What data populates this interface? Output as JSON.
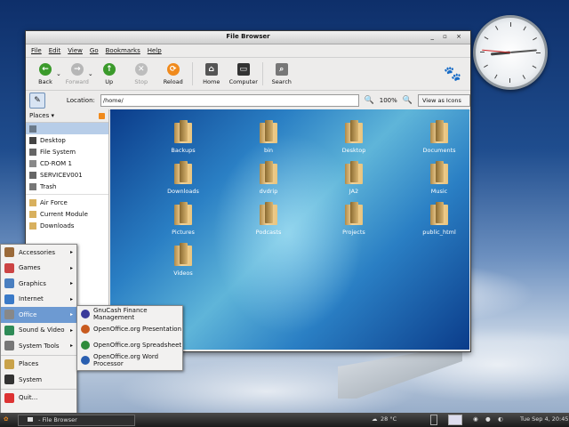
{
  "window": {
    "title": "File Browser",
    "controls": "_ ▫ ×",
    "menus": [
      "File",
      "Edit",
      "View",
      "Go",
      "Bookmarks",
      "Help"
    ],
    "toolbar": [
      {
        "label": "Back",
        "icon": "back-arrow-icon",
        "color": "#3b9a2b",
        "dim": false
      },
      {
        "label": "Forward",
        "icon": "forward-arrow-icon",
        "color": "#b6b6b6",
        "dim": true
      },
      {
        "label": "Up",
        "icon": "up-arrow-icon",
        "color": "#3b9a2b",
        "dim": false
      },
      {
        "label": "Stop",
        "icon": "stop-icon",
        "color": "#bdbdbd",
        "dim": true
      },
      {
        "label": "Reload",
        "icon": "reload-icon",
        "color": "#f08a1c",
        "dim": false
      },
      {
        "label": "Home",
        "icon": "home-icon",
        "color": "#555555",
        "dim": false
      },
      {
        "label": "Computer",
        "icon": "computer-icon",
        "color": "#333333",
        "dim": false
      },
      {
        "label": "Search",
        "icon": "search-icon",
        "color": "#777777",
        "dim": false
      }
    ],
    "location_label": "Location:",
    "location_value": "/home/",
    "zoom": "100%",
    "view_mode": "View as Icons"
  },
  "sidebar": {
    "header": "Places ▾",
    "items": [
      {
        "label": "",
        "icon": "home-icon",
        "selected": true
      },
      {
        "label": "Desktop",
        "icon": "desktop-icon"
      },
      {
        "label": "File System",
        "icon": "drive-icon"
      },
      {
        "label": "CD-ROM 1",
        "icon": "cdrom-icon"
      },
      {
        "label": "SERVICEV001",
        "icon": "drive-icon"
      },
      {
        "label": "Trash",
        "icon": "trash-icon"
      },
      {
        "label": "Air Force",
        "icon": "folder-icon"
      },
      {
        "label": "Current Module",
        "icon": "folder-icon"
      },
      {
        "label": "Downloads",
        "icon": "folder-icon"
      }
    ]
  },
  "files": [
    "Backups",
    "bin",
    "Desktop",
    "Documents",
    "Downloads",
    "dvdrip",
    "JA2",
    "Music",
    "Pictures",
    "Podcasts",
    "Projects",
    "public_html",
    "Videos"
  ],
  "app_menu": [
    {
      "label": "Accessories",
      "has_sub": true,
      "color": "#9b6a3a"
    },
    {
      "label": "Games",
      "has_sub": true,
      "color": "#c44"
    },
    {
      "label": "Graphics",
      "has_sub": true,
      "color": "#4a7fc0"
    },
    {
      "label": "Internet",
      "has_sub": true,
      "color": "#3a7ac8"
    },
    {
      "label": "Office",
      "has_sub": true,
      "color": "#888",
      "highlighted": true
    },
    {
      "label": "Sound & Video",
      "has_sub": true,
      "color": "#2e8b57"
    },
    {
      "label": "System Tools",
      "has_sub": true,
      "color": "#777"
    },
    {
      "label": "Places",
      "has_sub": false,
      "color": "#c9a24a"
    },
    {
      "label": "System",
      "has_sub": false,
      "color": "#333"
    },
    {
      "label": "Quit...",
      "has_sub": false,
      "color": "#d33"
    }
  ],
  "office_submenu": [
    {
      "label": "GnuCash Finance Management",
      "color": "#3a3a9a"
    },
    {
      "label": "OpenOffice.org Presentation",
      "color": "#c85a1e"
    },
    {
      "label": "OpenOffice.org Spreadsheet",
      "color": "#2e8b3a"
    },
    {
      "label": "OpenOffice.org Word Processor",
      "color": "#2a5fb0"
    }
  ],
  "taskbar": {
    "task_label": " - File Browser",
    "weather": "28 °C",
    "datetime": "Tue Sep  4, 20:45"
  }
}
